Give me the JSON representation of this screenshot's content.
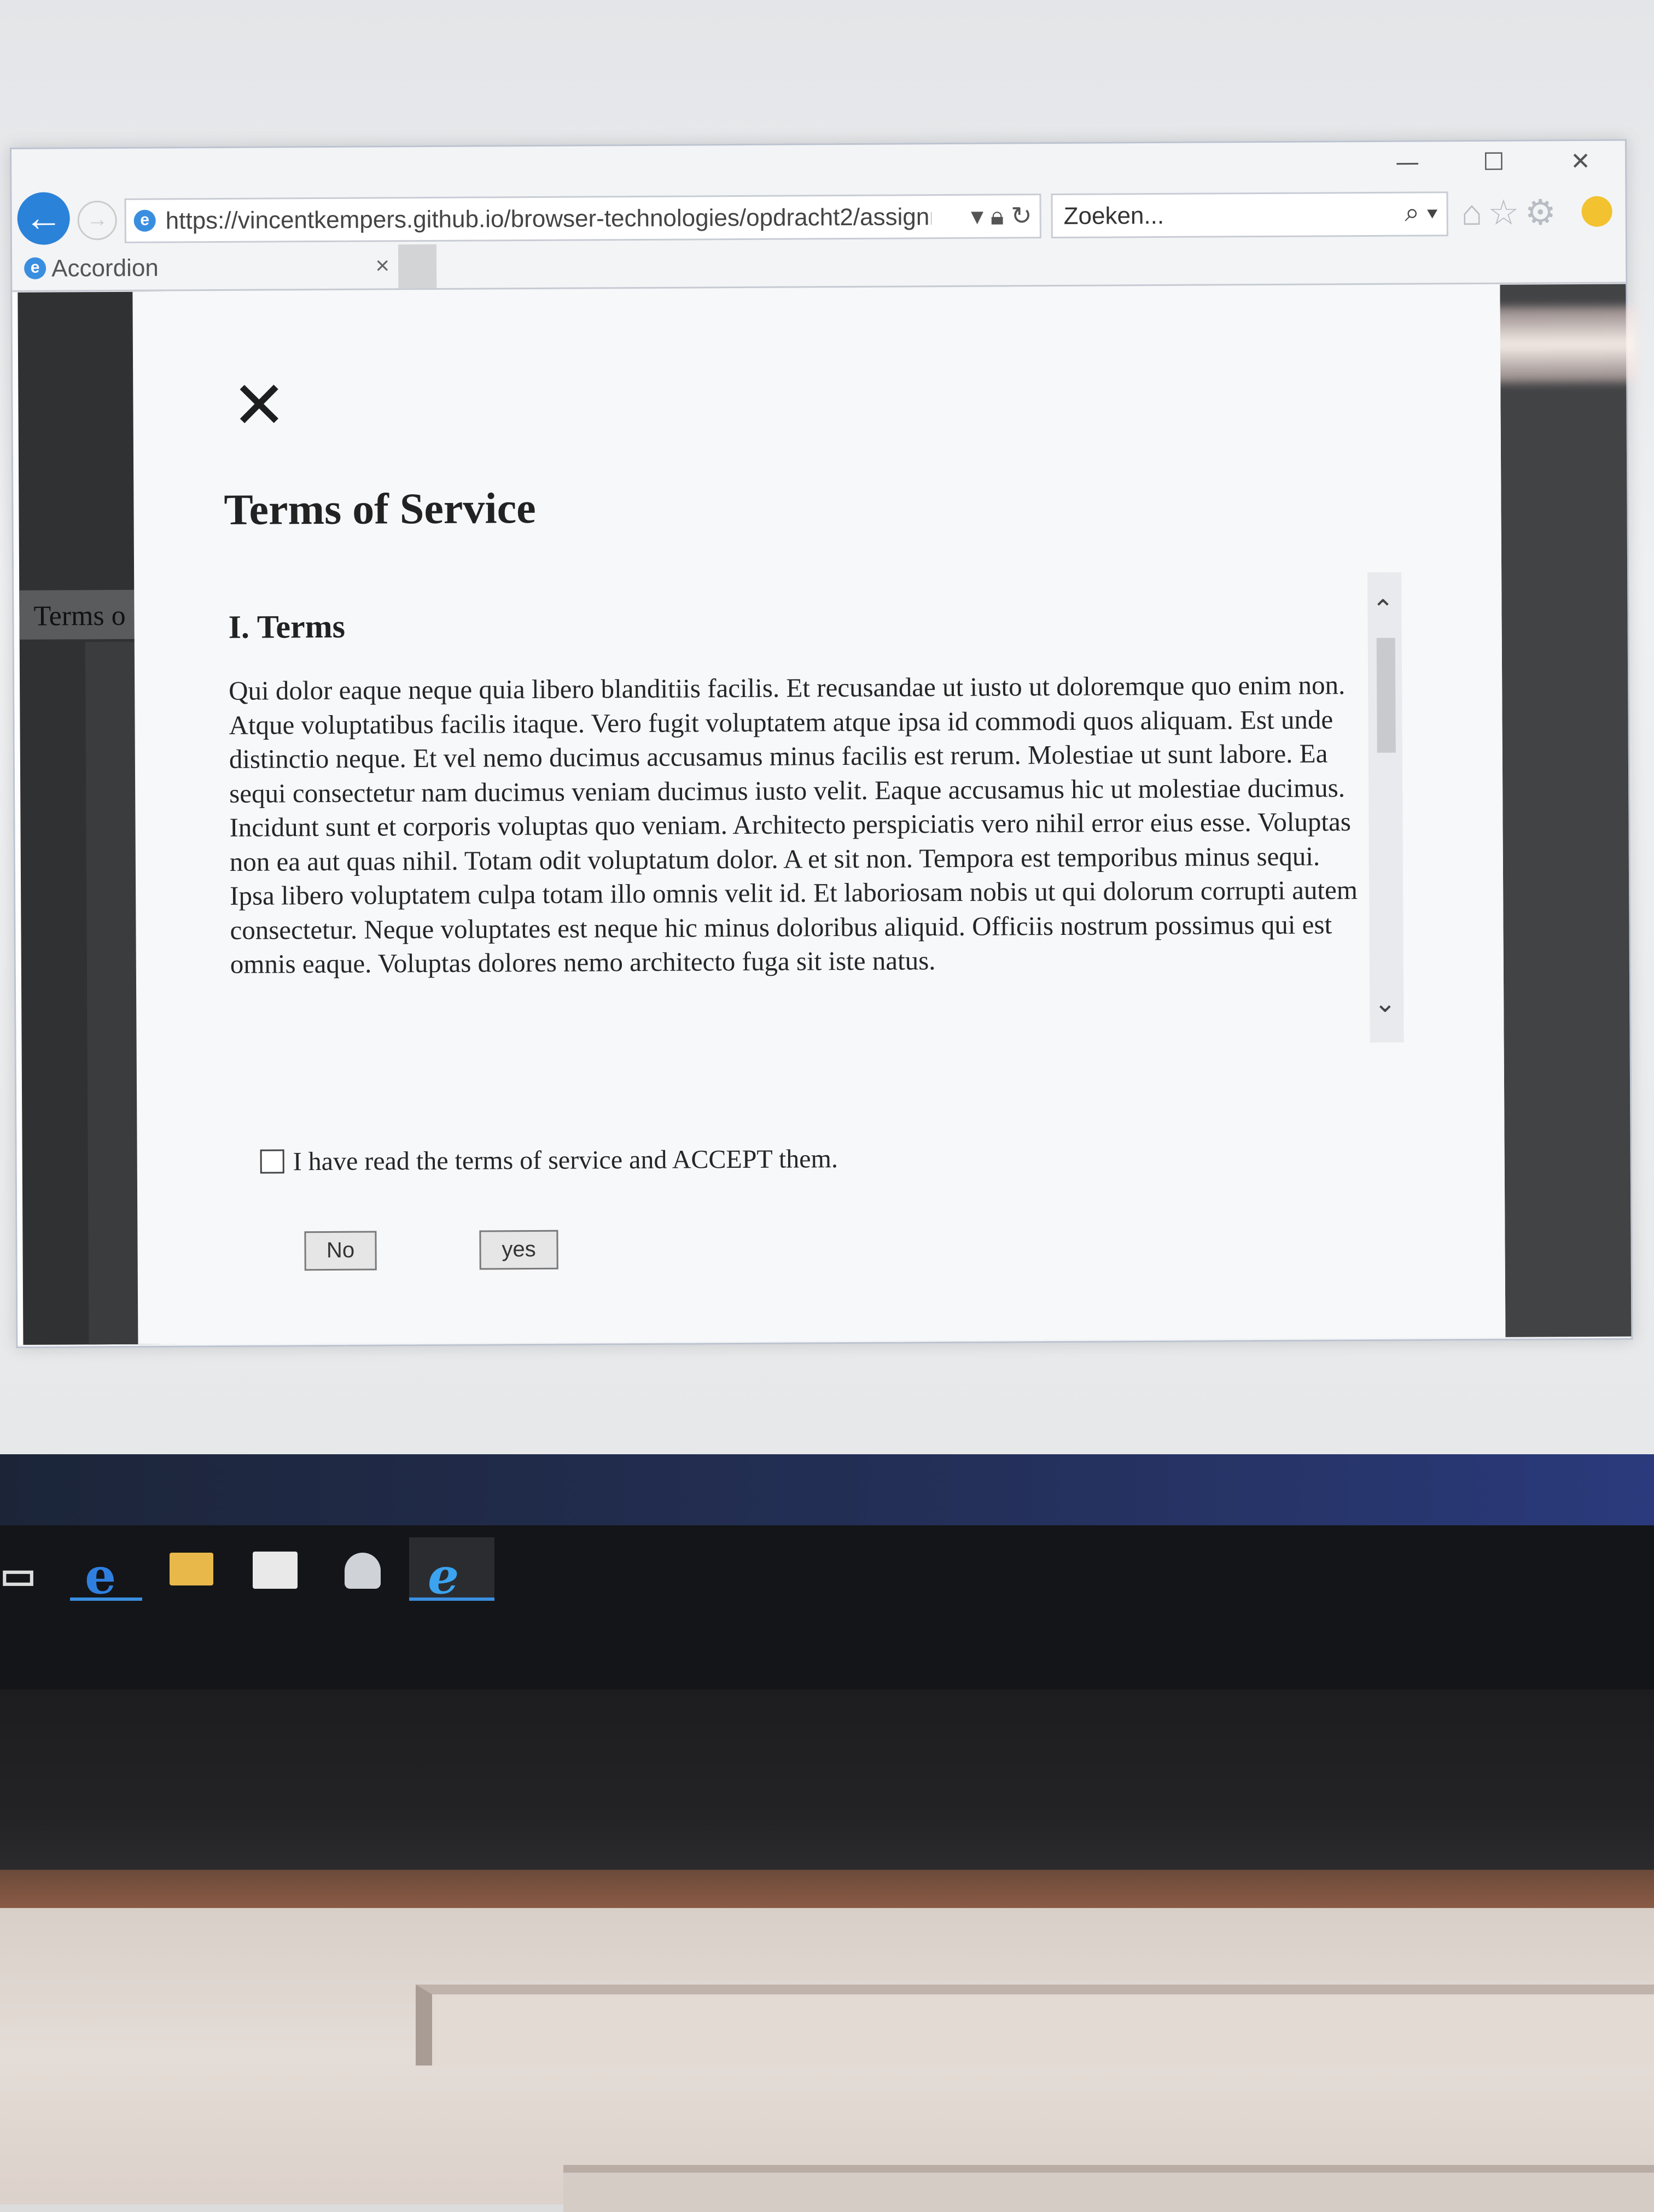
{
  "browser": {
    "url": "https://vincentkempers.github.io/browser-technologies/opdracht2/assignmer",
    "search_placeholder": "Zoeken...",
    "tab_label": "Accordion",
    "tab_close": "×",
    "window_controls": {
      "minimize": "—",
      "maximize": "☐",
      "close": "✕"
    },
    "icons": [
      "back-arrow-icon",
      "forward-icon",
      "ie-icon",
      "lock-icon",
      "refresh-icon",
      "search-icon",
      "home-icon",
      "star-icon",
      "gear-icon",
      "smiley-icon"
    ]
  },
  "sidebar": {
    "visible_item": "Terms o"
  },
  "modal": {
    "close_symbol": "✕",
    "title": "Terms of Service",
    "section_heading": "I. Terms",
    "body": "Qui dolor eaque neque quia libero blanditiis facilis. Et recusandae ut iusto ut doloremque quo enim non. Atque voluptatibus facilis itaque. Vero fugit voluptatem atque ipsa id commodi quos aliquam. Est unde distinctio neque. Et vel nemo ducimus accusamus minus facilis est rerum. Molestiae ut sunt labore. Ea sequi consectetur nam ducimus veniam ducimus iusto velit. Eaque accusamus hic ut molestiae ducimus. Incidunt sunt et corporis voluptas quo veniam. Architecto perspiciatis vero nihil error eius esse. Voluptas non ea aut quas nihil. Totam odit voluptatum dolor. A et sit non. Tempora est temporibus minus sequi. Ipsa libero voluptatem culpa totam illo omnis velit id. Et laboriosam nobis ut qui dolorum corrupti autem consectetur. Neque voluptates est neque hic minus doloribus aliquid. Officiis nostrum possimus qui est omnis eaque. Voluptas dolores nemo architecto fuga sit iste natus.",
    "checkbox_label": "I have read the terms of service and ACCEPT them.",
    "checkbox_checked": false,
    "button_no": "No",
    "button_yes": "yes"
  },
  "taskbar": {
    "icons": [
      "task-view-icon",
      "edge-icon",
      "file-explorer-icon",
      "store-icon",
      "app-icon",
      "internet-explorer-icon"
    ]
  }
}
